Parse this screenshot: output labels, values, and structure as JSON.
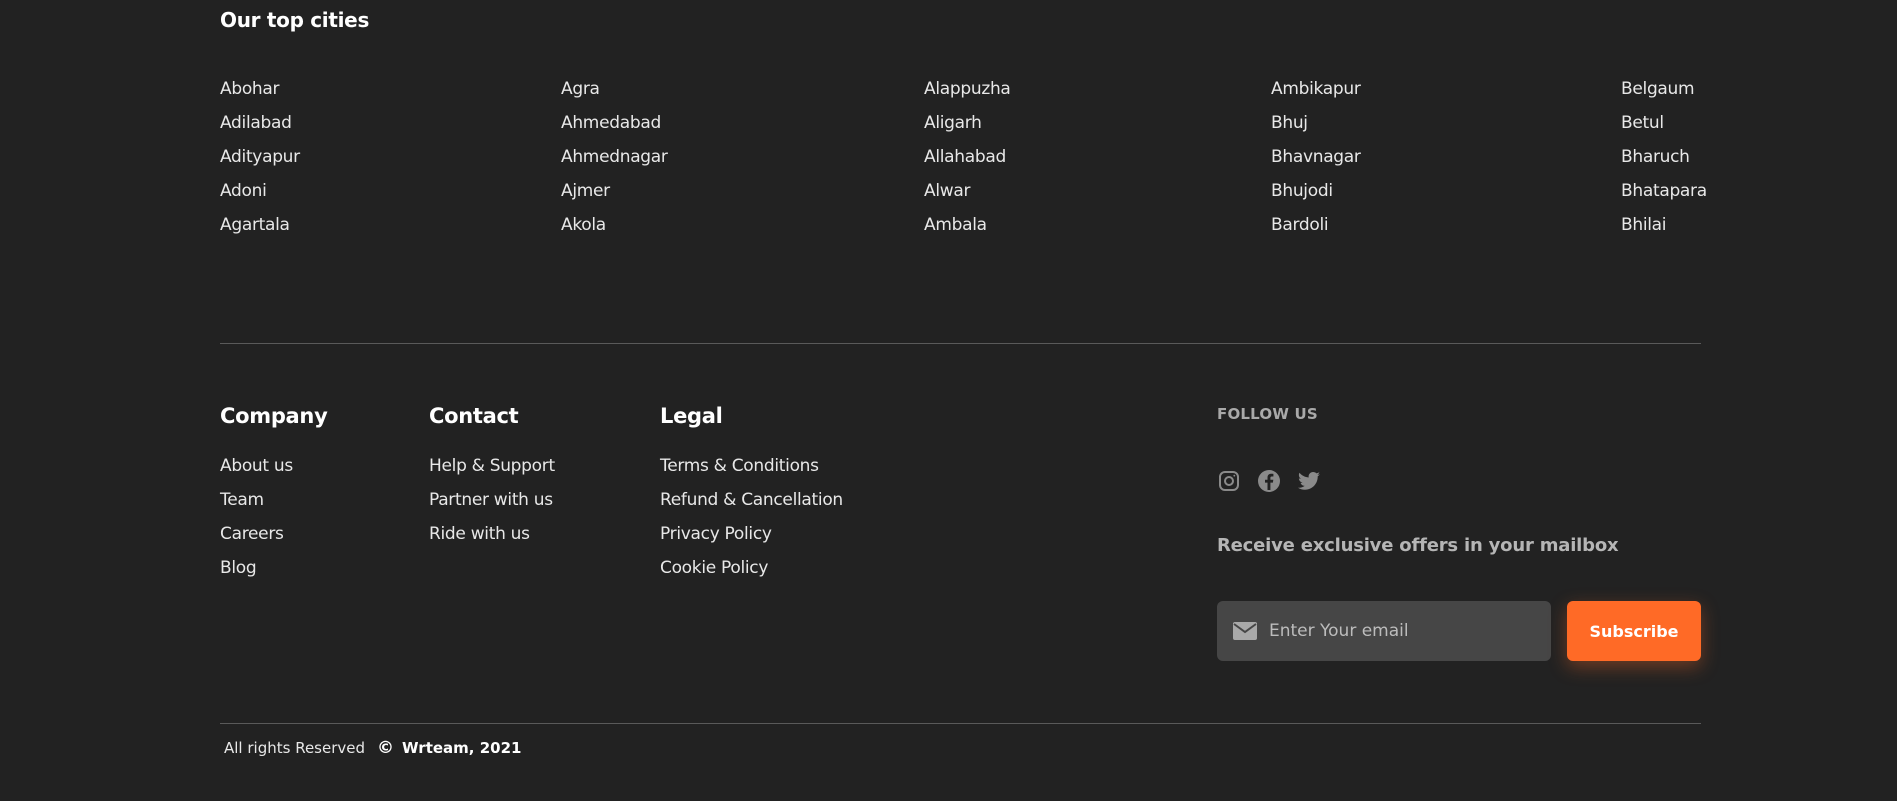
{
  "cities": {
    "title": "Our top cities",
    "columns": [
      [
        "Abohar",
        "Adilabad",
        "Adityapur",
        "Adoni",
        "Agartala"
      ],
      [
        "Agra",
        "Ahmedabad",
        "Ahmednagar",
        "Ajmer",
        "Akola"
      ],
      [
        "Alappuzha",
        "Aligarh",
        "Allahabad",
        "Alwar",
        "Ambala"
      ],
      [
        "Ambikapur",
        "Bhuj",
        "Bhavnagar",
        "Bhujodi",
        "Bardoli"
      ],
      [
        "Belgaum",
        "Betul",
        "Bharuch",
        "Bhatapara",
        "Bhilai"
      ]
    ]
  },
  "footer": {
    "company": {
      "heading": "Company",
      "links": [
        "About us",
        "Team",
        "Careers",
        "Blog"
      ]
    },
    "contact": {
      "heading": "Contact",
      "links": [
        "Help & Support",
        "Partner with us",
        "Ride with us"
      ]
    },
    "legal": {
      "heading": "Legal",
      "links": [
        "Terms & Conditions",
        "Refund & Cancellation",
        "Privacy Policy",
        "Cookie Policy"
      ]
    },
    "follow": {
      "label": "FOLLOW US",
      "icons": [
        "instagram-icon",
        "facebook-icon",
        "twitter-icon"
      ]
    },
    "newsletter": {
      "text": "Receive exclusive offers in your mailbox",
      "placeholder": "Enter Your email",
      "button_label": "Subscribe"
    }
  },
  "copyright": {
    "text": "All rights Reserved",
    "symbol": "©",
    "brand": "Wrteam, 2021"
  },
  "colors": {
    "background": "#222222",
    "accent": "#ff6a26",
    "input_bg": "#464646",
    "divider": "#5a5a5a"
  }
}
